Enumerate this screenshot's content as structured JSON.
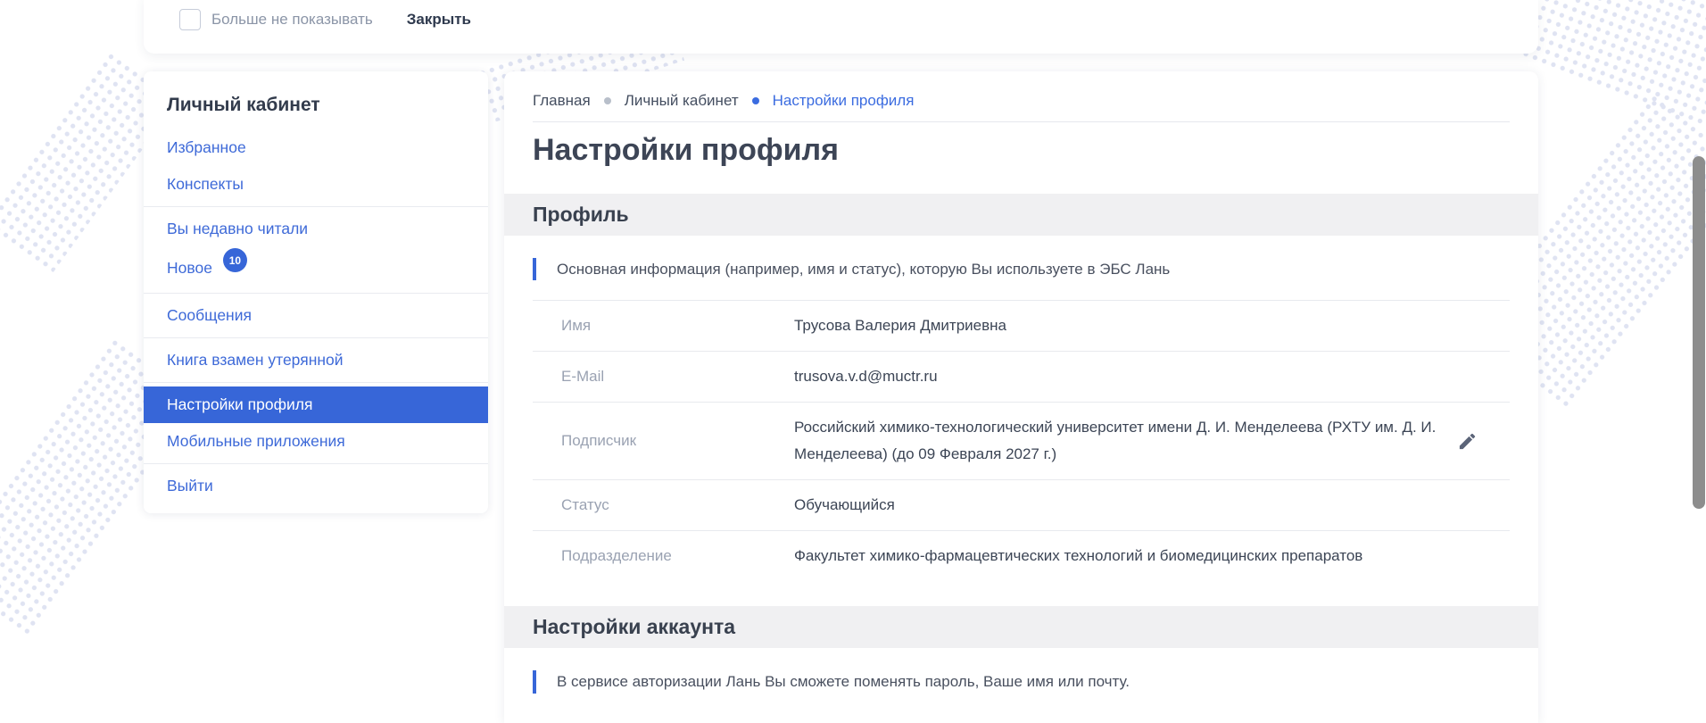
{
  "banner": {
    "checkbox_label": "Больше не показывать",
    "checkbox_checked": false,
    "close_label": "Закрыть"
  },
  "sidebar": {
    "title": "Личный кабинет",
    "items": [
      {
        "label": "Избранное"
      },
      {
        "label": "Конспекты",
        "divider_after": true
      },
      {
        "label": "Вы недавно читали"
      },
      {
        "label": "Новое",
        "badge": "10",
        "divider_after": true
      },
      {
        "label": "Сообщения",
        "divider_after": true
      },
      {
        "label": "Книга взамен утерянной",
        "divider_after": true
      },
      {
        "label": "Настройки профиля",
        "active": true
      },
      {
        "label": "Мобильные приложения",
        "divider_after": true
      },
      {
        "label": "Выйти"
      }
    ]
  },
  "breadcrumb": {
    "items": [
      "Главная",
      "Личный кабинет",
      "Настройки профиля"
    ]
  },
  "page": {
    "title": "Настройки профиля"
  },
  "profile_section": {
    "title": "Профиль",
    "note": "Основная информация (например, имя и статус), которую Вы используете в ЭБС Лань",
    "fields": [
      {
        "label": "Имя",
        "value": "Трусова Валерия Дмитриевна"
      },
      {
        "label": "E-Mail",
        "value": "trusova.v.d@muctr.ru"
      },
      {
        "label": "Подписчик",
        "value": "Российский химико-технологический университет имени Д. И. Менделеева (РХТУ им. Д. И. Менделеева) (до 09 Февраля 2027 г.)",
        "editable": true
      },
      {
        "label": "Статус",
        "value": "Обучающийся"
      },
      {
        "label": "Подразделение",
        "value": "Факультет химико-фармацевтических технологий и биомедицинских препаратов"
      }
    ]
  },
  "account_section": {
    "title": "Настройки аккаунта",
    "note": "В сервисе авторизации Лань Вы сможете поменять пароль, Ваше имя или почту."
  },
  "colors": {
    "accent_blue": "#3766d8",
    "link_blue": "#3e6ad8",
    "breadcrumb_active": "#3b6ce0",
    "section_band_bg": "#f0f0f2",
    "dots": "#dfe3f2",
    "scrollbar_thumb": "#8d8d8d"
  }
}
